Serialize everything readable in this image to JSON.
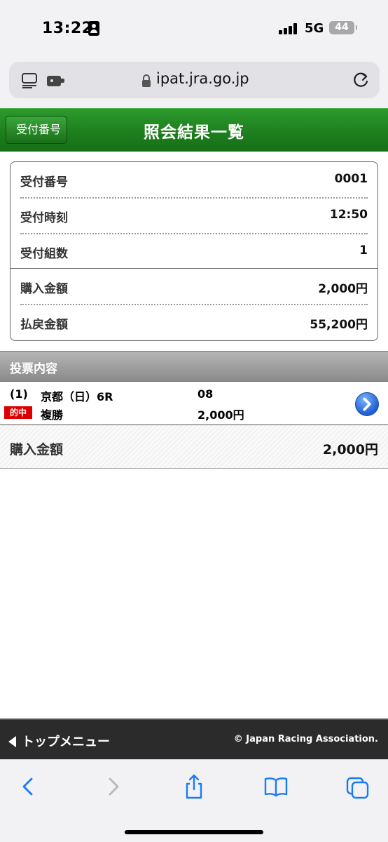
{
  "status_bar": {
    "time": "13:22",
    "network": "5G",
    "battery": "44"
  },
  "browser": {
    "url": "ipat.jra.go.jp"
  },
  "header": {
    "back_label": "受付番号",
    "title": "照会結果一覧"
  },
  "info": [
    {
      "label": "受付番号",
      "value": "0001"
    },
    {
      "label": "受付時刻",
      "value": "12:50"
    },
    {
      "label": "受付組数",
      "value": "1"
    },
    {
      "label": "購入金額",
      "value": "2,000円"
    },
    {
      "label": "払戻金額",
      "value": "55,200円"
    }
  ],
  "section": {
    "title": "投票内容"
  },
  "bet": {
    "number": "(1)",
    "race": "京都（日）6R",
    "combination": "08",
    "hit_badge": "的中",
    "type": "複勝",
    "amount": "2,000円"
  },
  "total": {
    "label": "購入金額",
    "value": "2,000円"
  },
  "footer": {
    "top_menu": "トップメニュー",
    "copyright": "© Japan Racing Association."
  },
  "colors": {
    "header_green": "#1d7f1d",
    "hit_red": "#dd0000",
    "link_blue": "#1c5fd0",
    "browser_blue": "#1a7cf5"
  }
}
